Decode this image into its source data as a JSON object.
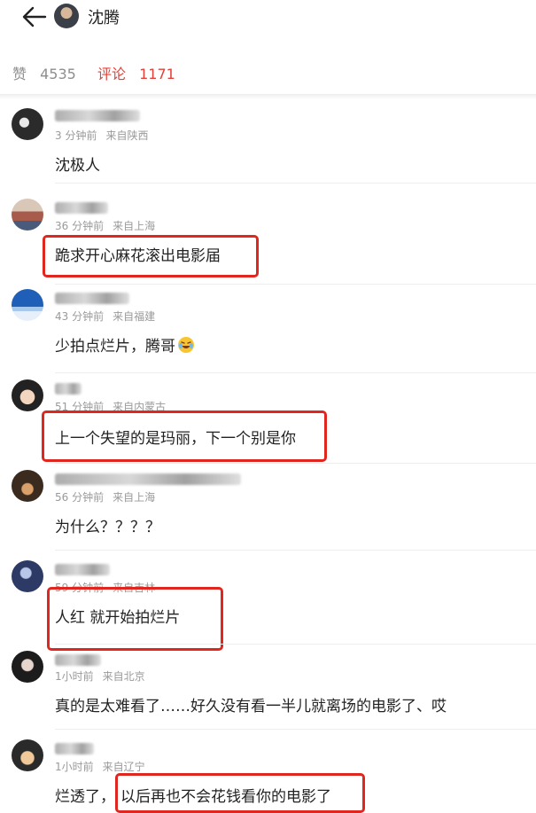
{
  "header": {
    "title": "沈腾"
  },
  "stats": {
    "likes_label": "赞",
    "likes_count": "4535",
    "comments_label": "评论",
    "comments_count": "1171"
  },
  "comments": [
    {
      "time": "3 分钟前",
      "location": "来自陕西",
      "text": "沈极人"
    },
    {
      "time": "36 分钟前",
      "location": "来自上海",
      "text": "跪求开心麻花滚出电影届"
    },
    {
      "time": "43 分钟前",
      "location": "来自福建",
      "text": "少拍点烂片，腾哥"
    },
    {
      "time": "51 分钟前",
      "location": "来自内蒙古",
      "text": "上一个失望的是玛丽，下一个别是你"
    },
    {
      "time": "56 分钟前",
      "location": "来自上海",
      "text": "为什么？？？？"
    },
    {
      "time": "59 分钟前",
      "location": "来自吉林",
      "text": "人红 就开始拍烂片"
    },
    {
      "time": "1小时前",
      "location": "来自北京",
      "text": "真的是太难看了……好久没有看一半儿就离场的电影了、哎"
    },
    {
      "time": "1小时前",
      "location": "来自辽宁",
      "text_prefix": "烂透了，",
      "text": "以后再也不会花钱看你的电影了"
    }
  ],
  "icons": {
    "back": "arrow-left-icon",
    "emoji": "laughing-crying-emoji"
  },
  "colors": {
    "accent": "#e0423a",
    "highlight_box": "#e0271f",
    "muted": "#9a9a9a"
  }
}
